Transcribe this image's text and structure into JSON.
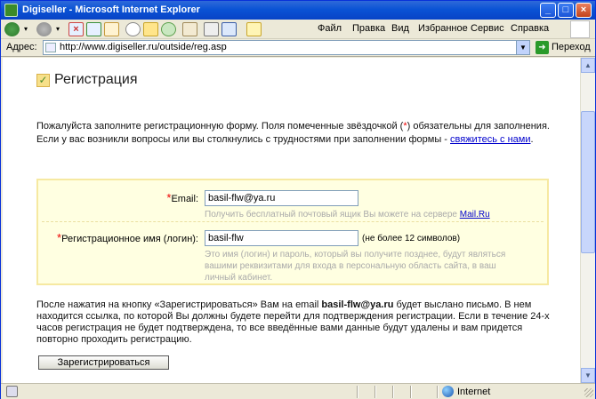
{
  "window": {
    "title": "Digiseller - Microsoft Internet Explorer",
    "min_label": "_",
    "max_label": "□",
    "close_label": "×"
  },
  "menu": [
    "Файл",
    "Правка",
    "Вид",
    "Избранное",
    "Сервис",
    "Справка"
  ],
  "address": {
    "label": "Адрес:",
    "url": "http://www.digiseller.ru/outside/reg.asp",
    "go_label": "Переход"
  },
  "status": {
    "zone": "Internet"
  },
  "page": {
    "title": "Регистрация",
    "intro_part1": "Пожалуйста заполните регистрационную форму. Поля помеченные звёздочкой (",
    "intro_star": "*",
    "intro_part2": ") обязательны для заполнения. Если у вас возникли вопросы или вы столкнулись с трудностями при заполнении формы -",
    "contact_link": "свяжитесь с нами",
    "intro_end": ".",
    "email": {
      "star": "*",
      "label": "Email:",
      "value": "basil-flw@ya.ru",
      "hint_text": "Получить бесплатный почтовый ящик Вы можете на сервере ",
      "hint_link": "Mail.Ru"
    },
    "login": {
      "star": "*",
      "label": "Регистрационное имя (логин):",
      "value": "basil-flw",
      "note": "(не более 12 символов)",
      "hint": "Это имя (логин) и пароль, который вы получите позднее, будут являться вашими реквизитами для входа в персональную область сайта, в ваш личный кабинет."
    },
    "after_part1": "После нажатия на кнопку «Зарегистрироваться» Вам на email ",
    "after_email": "basil-flw@ya.ru",
    "after_part2": " будет выслано письмо. В нем находится ссылка, по которой Вы должны будете перейти для подтверждения регистрации. Если в течение 24-х часов регистрация не будет подтверждена, то все введённые вами данные будут удалены и вам придется повторно проходить регистрацию.",
    "submit": "Зарегистрироваться"
  },
  "scrollbar": {
    "position": 0.25
  }
}
